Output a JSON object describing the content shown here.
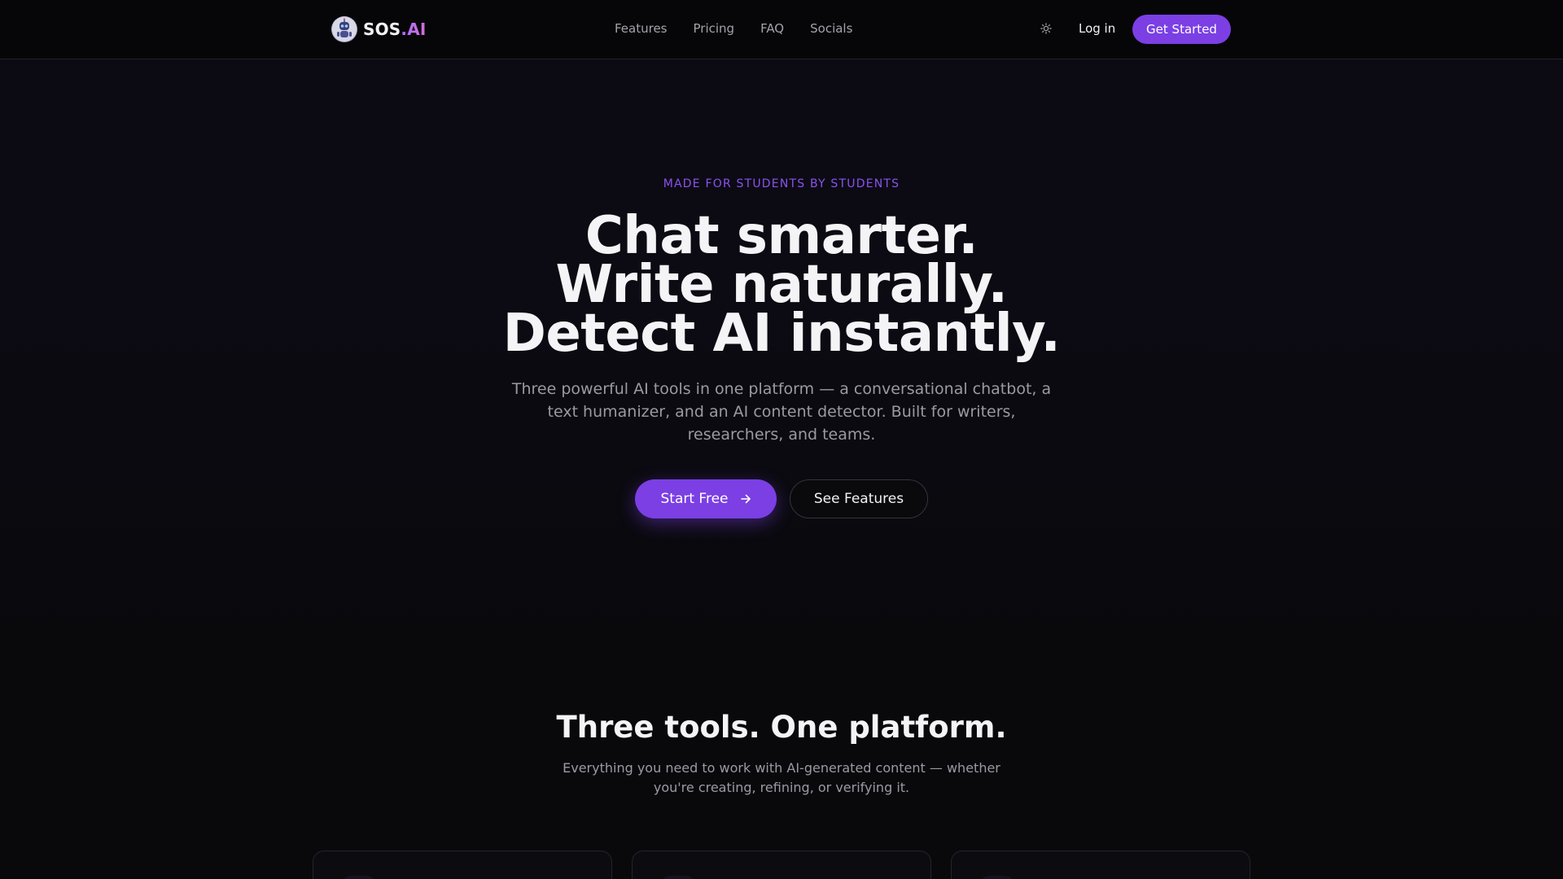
{
  "brand": {
    "name_main": "SOS",
    "name_accent": ".AI"
  },
  "nav": {
    "links": [
      "Features",
      "Pricing",
      "FAQ",
      "Socials"
    ],
    "theme_icon": "sun-icon",
    "login_label": "Log in",
    "cta_label": "Get Started"
  },
  "hero": {
    "eyebrow": "MADE FOR STUDENTS BY STUDENTS",
    "title_lines": [
      "Chat smarter.",
      "Write naturally.",
      "Detect AI instantly."
    ],
    "subtitle": "Three powerful AI tools in one platform — a conversational chatbot, a text humanizer, and an AI content detector. Built for writers, researchers, and teams.",
    "primary_label": "Start Free",
    "primary_icon": "arrow-right-icon",
    "secondary_label": "See Features"
  },
  "features": {
    "title": "Three tools. One platform.",
    "subtitle": "Everything you need to work with AI-generated content — whether you're creating, refining, or verifying it."
  },
  "colors": {
    "accent": "#7b3fe4",
    "eyebrow": "#8b52ee",
    "background": "#09090c",
    "nav_background": "#060608"
  }
}
